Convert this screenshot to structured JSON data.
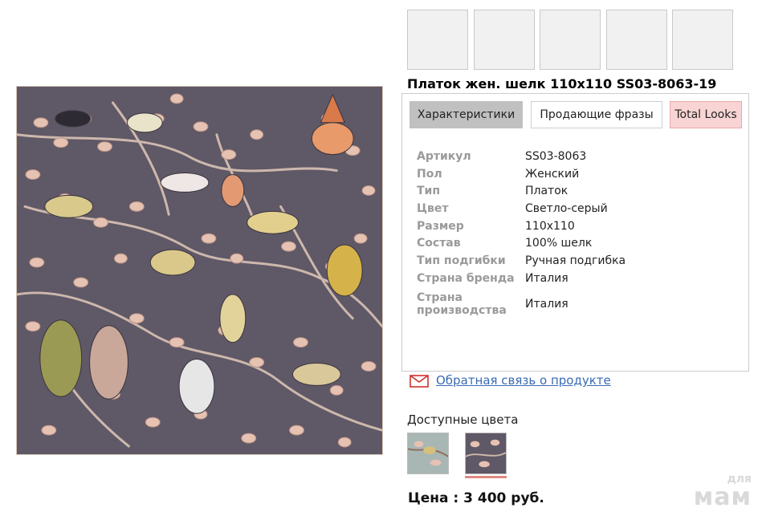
{
  "product": {
    "title": "Платок жен. шелк 110x110 SS03-8063-19",
    "image_alt": "scarf-image"
  },
  "tabs": [
    {
      "label": "Характеристики",
      "active": true
    },
    {
      "label": "Продающие фразы",
      "active": false
    },
    {
      "label": "Total Looks",
      "active": false
    }
  ],
  "specs": [
    {
      "key": "Артикул",
      "value": "SS03-8063"
    },
    {
      "key": "Пол",
      "value": "Женский"
    },
    {
      "key": "Тип",
      "value": "Платок"
    },
    {
      "key": "Цвет",
      "value": "Светло-серый"
    },
    {
      "key": "Размер",
      "value": "110x110"
    },
    {
      "key": "Состав",
      "value": "100% шелк"
    },
    {
      "key": "Тип подгибки",
      "value": "Ручная подгибка"
    },
    {
      "key": "Страна бренда",
      "value": "Италия"
    },
    {
      "key": "Страна производства",
      "value": "Италия"
    }
  ],
  "feedback": {
    "label": "Обратная связь о продукте"
  },
  "colors": {
    "label": "Доступные цвета"
  },
  "price": {
    "label": "Цена : 3 400 руб."
  },
  "watermark": {
    "line1": "для",
    "line2": "мам"
  },
  "theme": {
    "scarf_bg": "#5f5866",
    "leaf": "#e6c2b2",
    "link": "#3a6bb5",
    "mail_icon": "#d0302e",
    "tab_active_bg": "#c0c0c0",
    "tab_looks_bg": "#f9d4d4"
  }
}
